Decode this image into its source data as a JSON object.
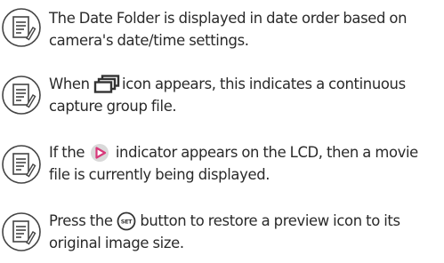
{
  "notes": [
    {
      "icon": "note-icon",
      "lines": [
        "The Date Folder is displayed in date order based on",
        "camera's date/time settings."
      ]
    },
    {
      "icon": "note-icon",
      "before": "When ",
      "inline_icon": "continuous-capture-group-icon",
      "after": "icon appears, this indicates a continuous",
      "line2": "capture group file."
    },
    {
      "icon": "note-icon",
      "before": "If the ",
      "inline_icon": "movie-play-indicator-icon",
      "after": " indicator appears on the LCD, then a movie",
      "line2": "file is currently being displayed."
    },
    {
      "icon": "note-icon",
      "before": "Press the ",
      "inline_icon": "set-button-icon",
      "inline_icon_text": "SET",
      "after": " button to restore a preview icon to its",
      "line2": "original image size."
    }
  ],
  "colors": {
    "text": "#2a2a2a",
    "icon_stroke": "#444444",
    "play_circle": "#d9d9d9",
    "play_arrow": "#d8387a"
  }
}
